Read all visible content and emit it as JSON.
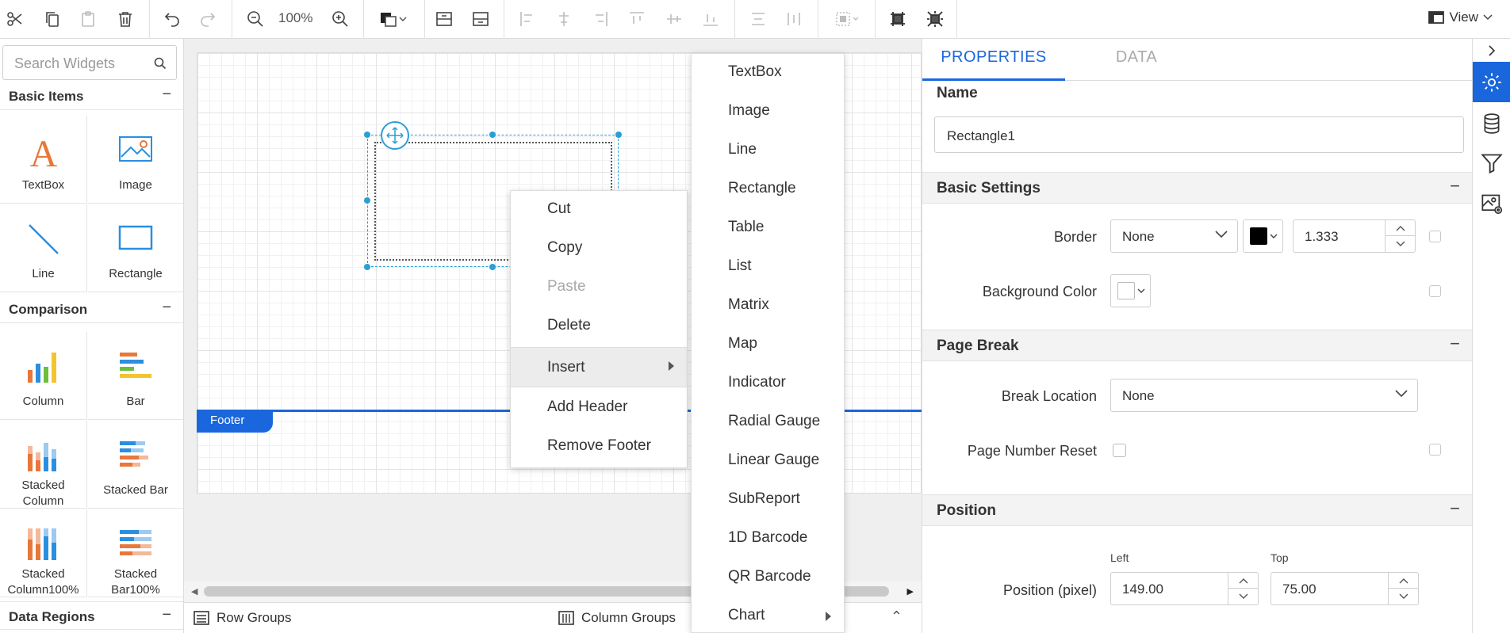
{
  "toolbar": {
    "zoom_level": "100%",
    "view_label": "View",
    "icons": [
      "cut-icon",
      "copy-icon",
      "paste-icon",
      "delete-icon",
      "undo-icon",
      "redo-icon",
      "zoom-out-icon",
      "zoom-in-icon",
      "layer-order-icon",
      "header-icon",
      "footer-icon",
      "align-left-icon",
      "align-center-icon",
      "align-right-icon",
      "align-top-icon",
      "align-middle-icon",
      "align-bottom-icon",
      "distribute-horizontal-icon",
      "distribute-vertical-icon",
      "group-icon",
      "fit-to-page-icon",
      "fit-to-width-icon",
      "view-icon"
    ]
  },
  "widgets": {
    "search_placeholder": "Search Widgets",
    "categories": [
      {
        "title": "Basic Items",
        "items": [
          "TextBox",
          "Image",
          "Line",
          "Rectangle"
        ]
      },
      {
        "title": "Comparison",
        "items": [
          "Column",
          "Bar",
          "Stacked Column",
          "Stacked Bar",
          "Stacked Column100%",
          "Stacked Bar100%"
        ]
      },
      {
        "title": "Data Regions"
      }
    ]
  },
  "design": {
    "footer_label": "Footer",
    "row_groups": "Row Groups",
    "column_groups": "Column Groups"
  },
  "context_menu": {
    "items": [
      "Cut",
      "Copy",
      "Paste",
      "Delete",
      "Insert",
      "Add Header",
      "Remove Footer"
    ],
    "disabled_item": "Paste",
    "highlighted_item": "Insert"
  },
  "insert_submenu": {
    "items": [
      "TextBox",
      "Image",
      "Line",
      "Rectangle",
      "Table",
      "List",
      "Matrix",
      "Map",
      "Indicator",
      "Radial Gauge",
      "Linear Gauge",
      "SubReport",
      "1D Barcode",
      "QR Barcode",
      "Chart"
    ]
  },
  "properties": {
    "tabs": [
      "PROPERTIES",
      "DATA"
    ],
    "active_tab": "PROPERTIES",
    "name_label": "Name",
    "name_value": "Rectangle1",
    "basic_settings": {
      "title": "Basic Settings",
      "border_label": "Border",
      "border_style": "None",
      "border_color": "#000000",
      "border_width": "1.333",
      "background_label": "Background Color",
      "background_color": "#ffffff"
    },
    "page_break": {
      "title": "Page Break",
      "break_location_label": "Break Location",
      "break_location": "None",
      "page_number_reset_label": "Page Number Reset",
      "page_number_reset": false
    },
    "position": {
      "title": "Position",
      "label": "Position (pixel)",
      "left_label": "Left",
      "top_label": "Top",
      "left": "149.00",
      "top": "75.00"
    }
  },
  "rail": {
    "icons": [
      "collapse-panel-icon",
      "properties-gear-icon",
      "data-source-icon",
      "filter-icon",
      "image-manager-icon"
    ],
    "active": "properties-gear-icon"
  },
  "colors": {
    "accent": "#1a66dd",
    "selection": "#2a9fd6"
  }
}
